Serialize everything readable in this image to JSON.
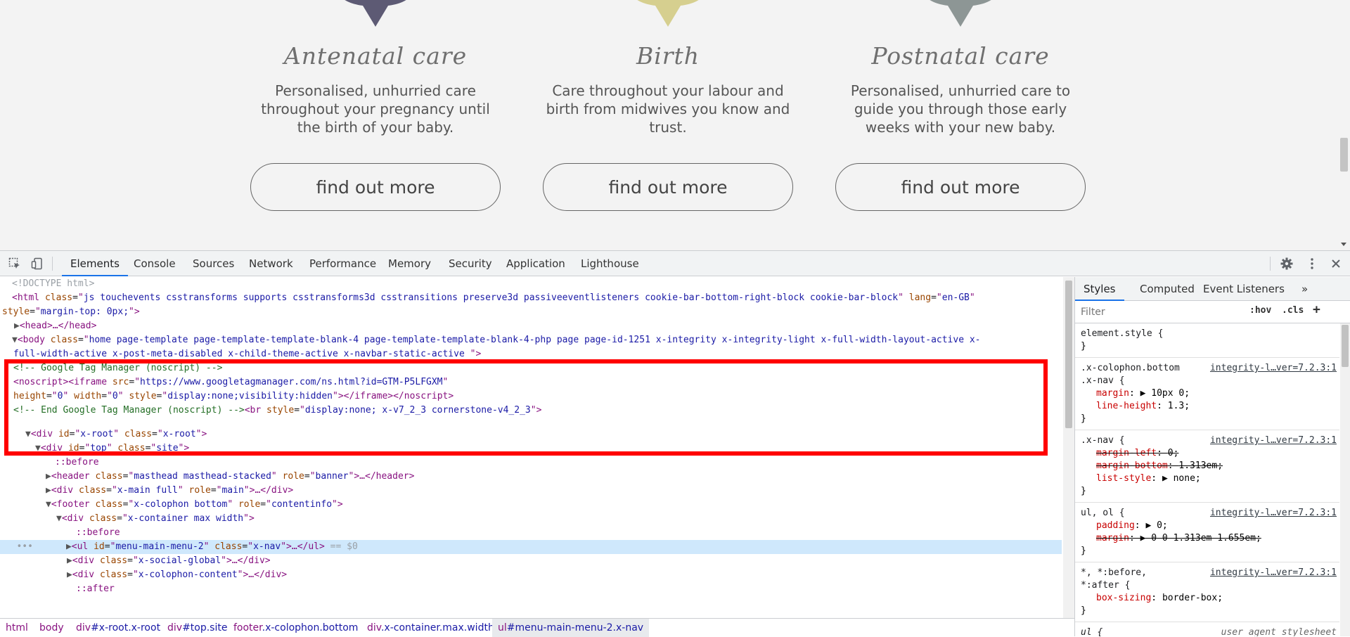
{
  "site": {
    "columns": [
      {
        "title": "Antenatal care",
        "text": "Personalised, unhurried care throughout your pregnancy until the birth of your baby.",
        "button": "find out more",
        "pin_color": "#5d5a74"
      },
      {
        "title": "Birth",
        "text": "Care throughout your labour and birth from midwives you know and trust.",
        "button": "find out more",
        "pin_color": "#d6cf8f"
      },
      {
        "title": "Postnatal care",
        "text": "Personalised, unhurried care to guide you through those early weeks with your new baby.",
        "button": "find out more",
        "pin_color": "#8d9695"
      }
    ]
  },
  "devtools": {
    "tabs": [
      "Elements",
      "Console",
      "Sources",
      "Network",
      "Performance",
      "Memory",
      "Security",
      "Application",
      "Lighthouse"
    ],
    "active_tab": "Elements",
    "dom": {
      "doctype": "<!DOCTYPE html>",
      "html_class": "js touchevents csstransforms supports csstransforms3d csstransitions preserve3d passiveeventlisteners cookie-bar-bottom-right-block cookie-bar-block",
      "html_lang": "en-GB",
      "html_style": "margin-top: 0px;",
      "head": "<head>…</head>",
      "body_class_1": "home page-template page-template-template-blank-4 page-template-template-blank-4-php page page-id-1251 x-integrity x-integrity-light x-full-width-layout-active x-",
      "body_class_2": "full-width-active x-post-meta-disabled x-child-theme-active x-navbar-static-active ",
      "comment_gtm": "<!-- Google Tag Manager (noscript) -->",
      "iframe_src": "https://www.googletagmanager.com/ns.html?id=GTM-P5LFGXM",
      "iframe_height": "0",
      "iframe_width": "0",
      "iframe_style": "display:none;visibility:hidden",
      "comment_end": "<!-- End Google Tag Manager (noscript) -->",
      "br_style": "display:none; x-v7_2_3 cornerstone-v4_2_3",
      "root_id": "x-root",
      "root_class": "x-root",
      "top_id": "top",
      "top_class": "site",
      "before": "::before",
      "header_class": "masthead masthead-stacked",
      "header_role": "banner",
      "main_class": "x-main full",
      "main_role": "main",
      "footer_class": "x-colophon bottom",
      "footer_role": "contentinfo",
      "container_class": "x-container max width",
      "ul_id": "menu-main-menu-2",
      "ul_class": "x-nav",
      "selected_marker": "== $0",
      "social_class": "x-social-global",
      "colophon_class": "x-colophon-content",
      "after": "::after"
    },
    "breadcrumbs": [
      {
        "tag": "html",
        "cls": ""
      },
      {
        "tag": "body",
        "cls": ""
      },
      {
        "tag": "div",
        "cls": "#x-root.x-root"
      },
      {
        "tag": "div",
        "cls": "#top.site"
      },
      {
        "tag": "footer",
        "cls": ".x-colophon.bottom"
      },
      {
        "tag": "div",
        "cls": ".x-container.max.width"
      },
      {
        "tag": "ul",
        "cls": "#menu-main-menu-2.x-nav"
      }
    ],
    "styles": {
      "tabs": [
        "Styles",
        "Computed",
        "Event Listeners"
      ],
      "more": "»",
      "filter_placeholder": "Filter",
      "hov": ":hov",
      "cls": ".cls",
      "plus": "+",
      "element_style": "element.style {",
      "close": "}",
      "rules": [
        {
          "selector": ".x-colophon.bottom\n.x-nav {",
          "source": "integrity-l…ver=7.2.3:1",
          "props": [
            {
              "n": "margin",
              "v": "▶ 10px 0;",
              "strike": false
            },
            {
              "n": "line-height",
              "v": "1.3;",
              "strike": false
            }
          ]
        },
        {
          "selector": ".x-nav {",
          "source": "integrity-l…ver=7.2.3:1",
          "props": [
            {
              "n": "margin-left",
              "v": "0;",
              "strike": true
            },
            {
              "n": "margin-bottom",
              "v": "1.313em;",
              "strike": true
            },
            {
              "n": "list-style",
              "v": "▶ none;",
              "strike": false
            }
          ]
        },
        {
          "selector": "ul, ol {",
          "source": "integrity-l…ver=7.2.3:1",
          "props": [
            {
              "n": "padding",
              "v": "▶ 0;",
              "strike": false
            },
            {
              "n": "margin",
              "v": "▶ 0 0 1.313em 1.655em;",
              "strike": true
            }
          ]
        },
        {
          "selector": "*, *:before,\n*:after {",
          "source": "integrity-l…ver=7.2.3:1",
          "props": [
            {
              "n": "box-sizing",
              "v": "border-box;",
              "strike": false
            }
          ]
        }
      ],
      "ua_selector": "ul {",
      "ua_source": "user agent stylesheet"
    }
  }
}
